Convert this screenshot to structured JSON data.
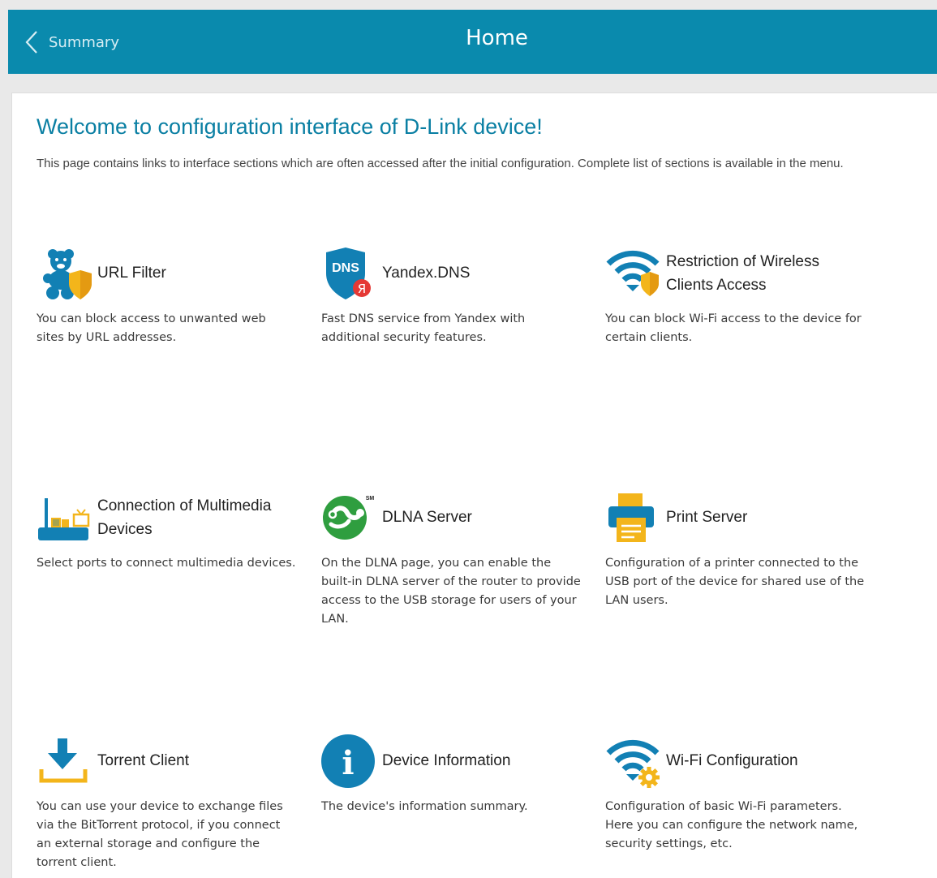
{
  "header": {
    "back_label": "Summary",
    "title": "Home"
  },
  "welcome": {
    "heading": "Welcome to configuration interface of D-Link device!",
    "intro": "This page contains links to interface sections which are often accessed after the initial configuration. Complete list of sections is available in the menu."
  },
  "tiles": [
    {
      "title": "URL Filter",
      "description": "You can block access to unwanted web sites by URL addresses.",
      "icon": "url-filter-icon"
    },
    {
      "title": "Yandex.DNS",
      "description": "Fast DNS service from Yandex with additional security features.",
      "icon": "yandex-dns-icon",
      "icon_text": "DNS",
      "badge_text": "Я"
    },
    {
      "title": "Restriction of Wireless Clients Access",
      "description": "You can block Wi-Fi access to the device for certain clients.",
      "icon": "wifi-shield-icon"
    },
    {
      "title": "Connection of Multimedia Devices",
      "description": "Select ports to connect multimedia devices.",
      "icon": "multimedia-icon"
    },
    {
      "title": "DLNA Server",
      "description": "On the DLNA page, you can enable the built-in DLNA server of the router to provide access to the USB storage for users of your LAN.",
      "icon": "dlna-icon",
      "icon_text": "SM"
    },
    {
      "title": "Print Server",
      "description": "Configuration of a printer connected to the USB port of the device for shared use of the LAN users.",
      "icon": "printer-icon"
    },
    {
      "title": "Torrent Client",
      "description": "You can use your device to exchange files via the BitTorrent protocol, if you connect an external storage and configure the torrent client.",
      "icon": "download-icon"
    },
    {
      "title": "Device Information",
      "description": "The device's information summary.",
      "icon": "info-icon",
      "icon_text": "i"
    },
    {
      "title": "Wi-Fi Configuration",
      "description": "Configuration of basic Wi-Fi parameters. Here you can configure the network name, security settings, etc.",
      "icon": "wifi-gear-icon"
    }
  ],
  "colors": {
    "header_bg": "#0a8aad",
    "heading": "#0a7fa3",
    "icon_blue": "#1280b4",
    "icon_orange": "#f3b51b",
    "dlna_green": "#2f9e3f",
    "yandex_red": "#e53935"
  }
}
